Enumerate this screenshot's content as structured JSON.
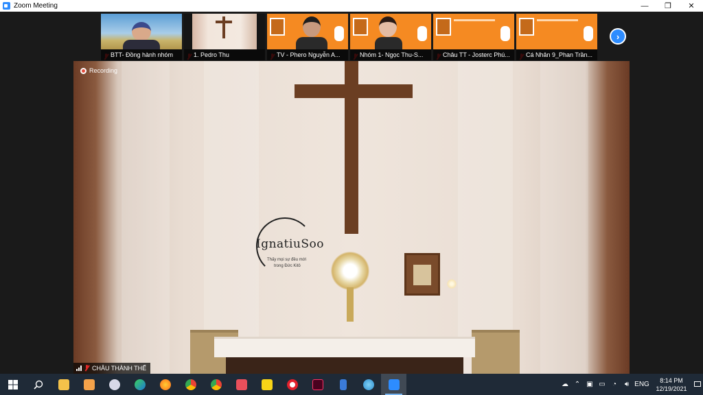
{
  "window": {
    "title": "Zoom Meeting",
    "minimize": "—",
    "restore": "❐",
    "close": "✕"
  },
  "thumbnails": [
    {
      "label": "BTT- Đồng hành nhóm",
      "muted": true
    },
    {
      "label": "1. Pedro Thu",
      "muted": true
    },
    {
      "label": "TV - Phero Nguyễn A...",
      "muted": true
    },
    {
      "label": "Nhóm 1- Ngọc Thu-S...",
      "muted": true
    },
    {
      "label": "Châu TT - Josterc Phú...",
      "muted": true
    },
    {
      "label": "Cá Nhân 9_Phan Trần...",
      "muted": true
    }
  ],
  "next_page_button": "›",
  "main_video": {
    "recording_label": "Recording",
    "speaker_name": "CHÂU THÀNH THẾ",
    "logo_text": "IgnatiuSoo",
    "logo_sub_1": "Thấy mọi sự đều mới",
    "logo_sub_2": "trong Đức Kitô"
  },
  "taskbar": {
    "clock_time": "8:14 PM",
    "clock_date": "12/19/2021",
    "language": "ENG",
    "apps": [
      "start",
      "search",
      "file-explorer",
      "media-player",
      "paint",
      "edge",
      "firefox",
      "chrome-alt",
      "chrome",
      "app-grid",
      "sticky-notes",
      "opera",
      "indesign",
      "stream",
      "browser",
      "zoom"
    ]
  },
  "colors": {
    "zoom_blue": "#2d8cff",
    "thumb_orange": "#f58a22",
    "muted_red": "#e02828",
    "taskbar_bg": "#1f2a37"
  }
}
